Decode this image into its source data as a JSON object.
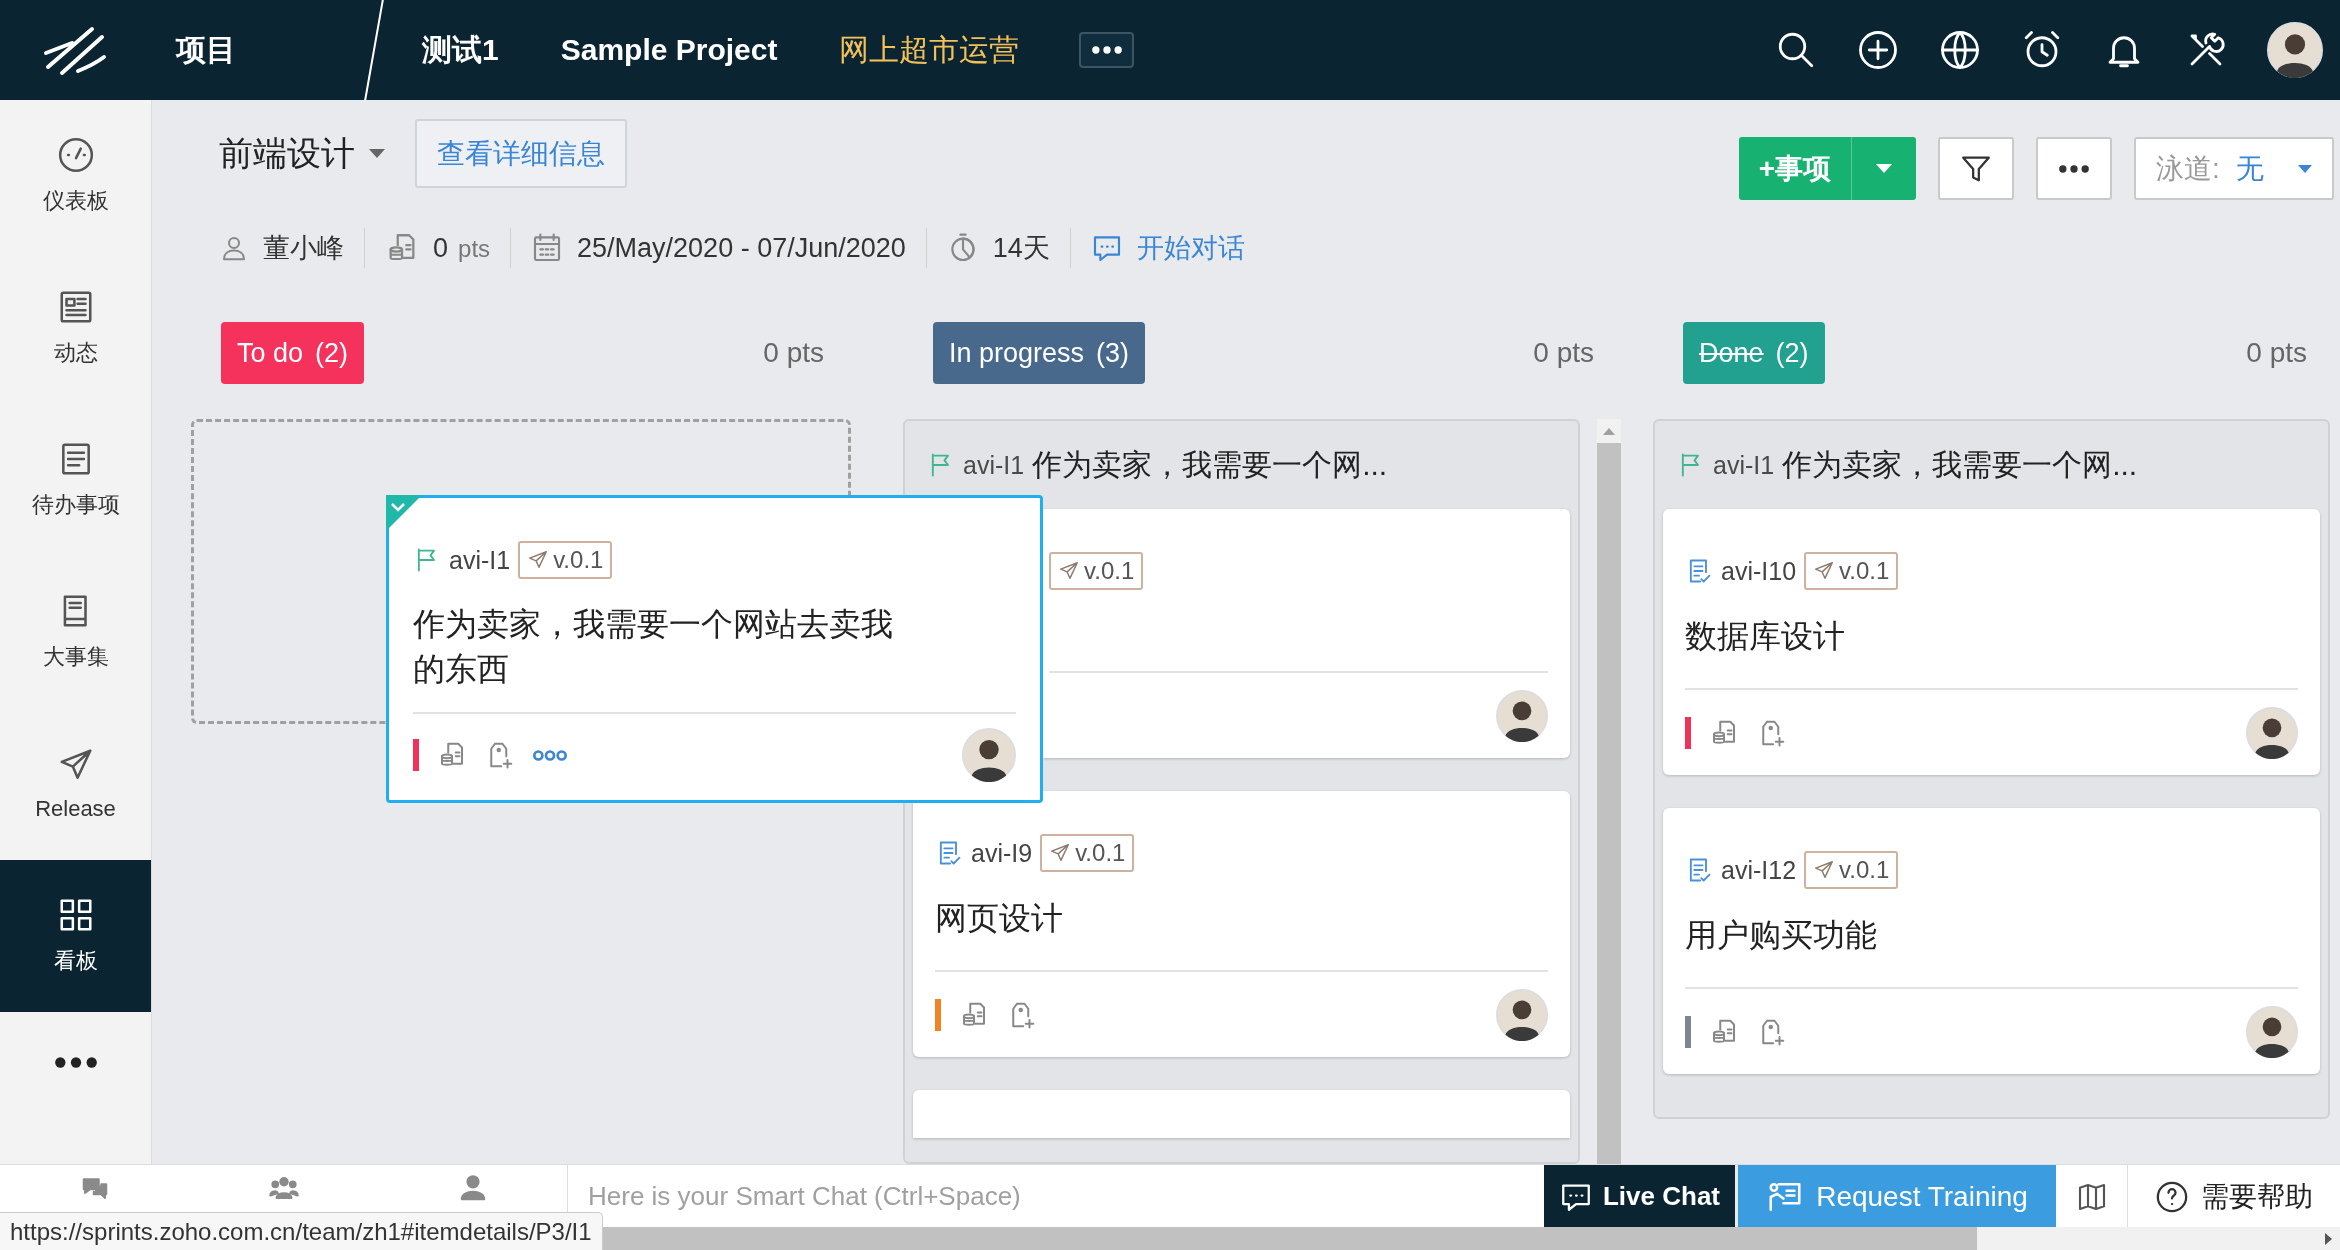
{
  "topbar": {
    "home": "项目",
    "nav": [
      {
        "label": "测试1",
        "selected": false
      },
      {
        "label": "Sample Project",
        "selected": false
      },
      {
        "label": "网上超市运营",
        "selected": true
      }
    ]
  },
  "sidebar": {
    "items": [
      {
        "label": "仪表板",
        "selected": false
      },
      {
        "label": "动态",
        "selected": false
      },
      {
        "label": "待办事项",
        "selected": false
      },
      {
        "label": "大事集",
        "selected": false
      },
      {
        "label": "Release",
        "selected": false
      },
      {
        "label": "看板",
        "selected": true
      }
    ]
  },
  "sprint": {
    "title": "前端设计",
    "details_button": "查看详细信息",
    "owner": "董小峰",
    "points": "0",
    "points_unit": "pts",
    "start": "25/May/2020",
    "date_separator": "-",
    "end": "07/Jun/2020",
    "duration": "14天",
    "chat_link": "开始对话"
  },
  "toolbar": {
    "add_button": "+事项",
    "lane_label": "泳道:",
    "lane_value": "无"
  },
  "columns": [
    {
      "title": "To do",
      "count": "(2)",
      "points": "0 pts",
      "color": "#f5325c",
      "strikethrough": false,
      "kind": "placeholder",
      "scrollable": false
    },
    {
      "title": "In progress",
      "count": "(3)",
      "points": "0 pts",
      "color": "#49698c",
      "strikethrough": false,
      "kind": "list",
      "scrollable": true,
      "group": {
        "id": "avi-I1",
        "title": "作为卖家，我需要一个网..."
      },
      "cards": [
        {
          "covered": true,
          "release": "v.0.1"
        },
        {
          "kind": "task",
          "id": "avi-I9",
          "release": "v.0.1",
          "title": "网页设计",
          "color": "#f28322"
        },
        {
          "cut": true
        }
      ]
    },
    {
      "title": "Done",
      "count": "(2)",
      "points": "0 pts",
      "color": "#22a090",
      "strikethrough": true,
      "kind": "list",
      "scrollable": false,
      "group": {
        "id": "avi-I1",
        "title": "作为卖家，我需要一个网..."
      },
      "cards": [
        {
          "kind": "task",
          "id": "avi-I10",
          "release": "v.0.1",
          "title": "数据库设计",
          "color": "#f0325a"
        },
        {
          "kind": "task",
          "id": "avi-I12",
          "release": "v.0.1",
          "title": "用户购买功能",
          "color": "#7d8590"
        }
      ]
    }
  ],
  "dragged_card": {
    "kind": "story",
    "id": "avi-I1",
    "release": "v.0.1",
    "title": "作为卖家，我需要一个网站去卖我的东西",
    "color": "#f0325a",
    "selected": true,
    "more_visible": true
  },
  "bottom_bar": {
    "placeholder": "Here is your Smart Chat (Ctrl+Space)",
    "live_chat": "Live Chat",
    "request_training": "Request Training",
    "help": "需要帮助"
  },
  "status_url": "https://sprints.zoho.com.cn/team/zh1#itemdetails/P3/I1"
}
